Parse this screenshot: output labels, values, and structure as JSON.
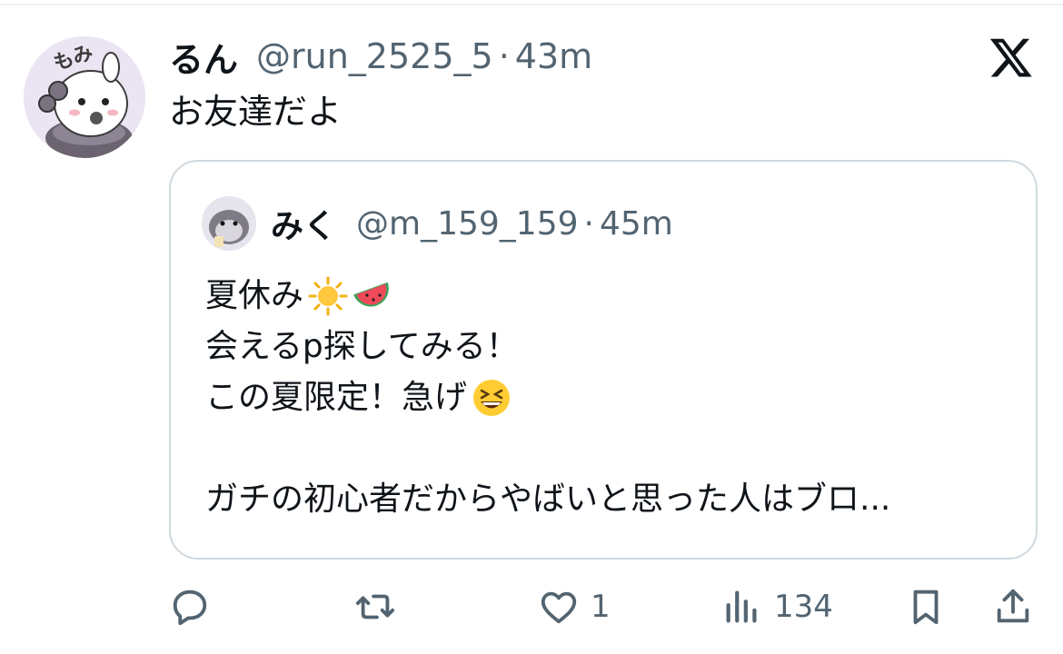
{
  "tweet": {
    "display_name": "るん",
    "handle": "@run_2525_5",
    "separator": "·",
    "time": "43m",
    "text": "お友達だよ",
    "avatar_label": "もみ"
  },
  "quoted_tweet": {
    "display_name": "みく",
    "handle": "@m_159_159",
    "separator": "·",
    "time": "45m",
    "lines": [
      "夏休み",
      "会えるp探してみる！",
      "この夏限定！急げ",
      "",
      "ガチの初心者だからやばいと思った人はブロ..."
    ],
    "emojis": [
      "sun-emoji",
      "watermelon-emoji",
      "grinning-squinting-emoji"
    ]
  },
  "actions": {
    "reply_count": "",
    "retweet_count": "",
    "like_count": "1",
    "views_count": "134"
  },
  "icons": [
    "x-logo-icon",
    "reply-icon",
    "retweet-icon",
    "like-icon",
    "views-icon",
    "bookmark-icon",
    "share-icon"
  ],
  "colors": {
    "text_primary": "#0f1419",
    "text_secondary": "#536471",
    "border": "#cfd9de"
  }
}
